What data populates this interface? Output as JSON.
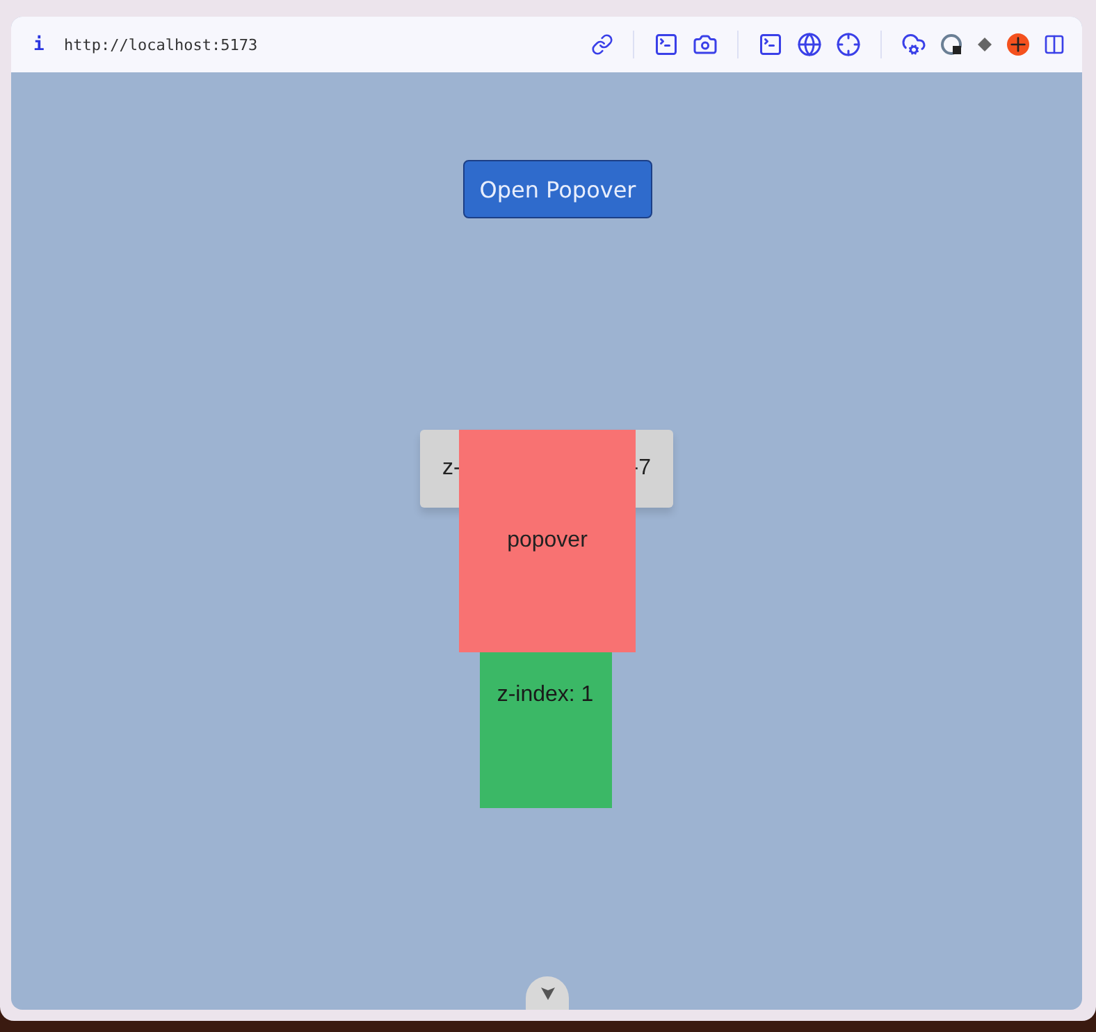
{
  "address_bar": {
    "info": "i",
    "url": "http://localhost:5173"
  },
  "button": {
    "label": "Open Popover"
  },
  "z_box": {
    "left_text": "z-",
    "right_text": "-7"
  },
  "popover": {
    "label": "popover"
  },
  "green_box": {
    "label": "z-index: 1"
  }
}
